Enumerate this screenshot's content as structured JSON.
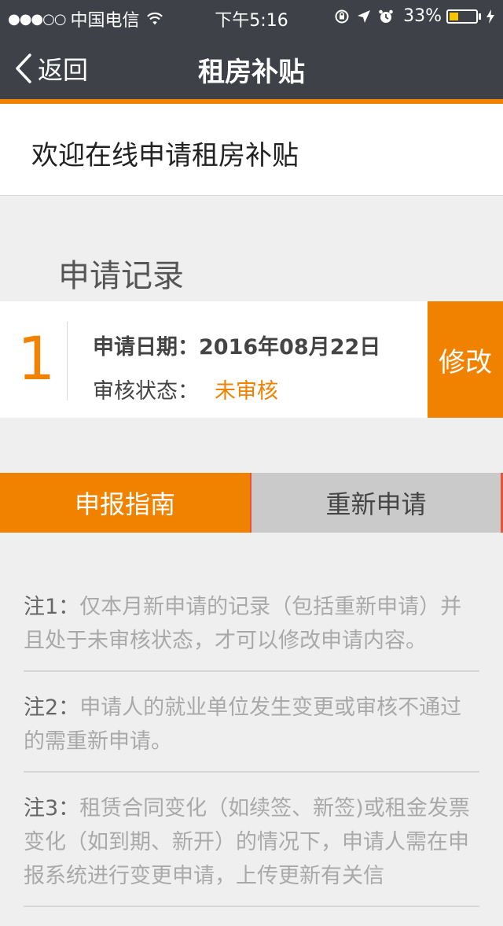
{
  "status_bar": {
    "signal": "●●●○○",
    "carrier": "中国电信",
    "time": "下午5:16",
    "battery_percent": "33%",
    "battery_level": 0.33,
    "icons": [
      "wifi-icon",
      "orientation-lock-icon",
      "location-arrow-icon",
      "alarm-icon",
      "battery-icon",
      "charging-bolt-icon"
    ]
  },
  "nav": {
    "back_label": "返回",
    "title": "租房补贴"
  },
  "welcome": "欢迎在线申请租房补贴",
  "records_section_title": "申请记录",
  "records": [
    {
      "index": "1",
      "date_label": "申请日期：",
      "date_value": "2016年08月22日",
      "status_label": "审核状态：",
      "status_value": "未审核",
      "edit_label": "修改"
    }
  ],
  "tabs": [
    {
      "label": "申报指南",
      "active": true
    },
    {
      "label": "重新申请",
      "active": false
    }
  ],
  "notes": [
    {
      "label": "注1：",
      "text": "仅本月新申请的记录（包括重新申请）并且处于未审核状态，才可以修改申请内容。"
    },
    {
      "label": "注2：",
      "text": "申请人的就业单位发生变更或审核不通过的需重新申请。"
    },
    {
      "label": "注3：",
      "text": "租赁合同变化（如续签、新签)或租金发票变化（如到期、新开）的情况下，申请人需在申报系统进行变更申请，上传更新有关信"
    }
  ],
  "colors": {
    "accent": "#f08200",
    "bar_bg": "#3e4148",
    "page_bg": "#efeff0",
    "tab_inactive": "#cacaca",
    "tab_divider": "#e5533b"
  }
}
